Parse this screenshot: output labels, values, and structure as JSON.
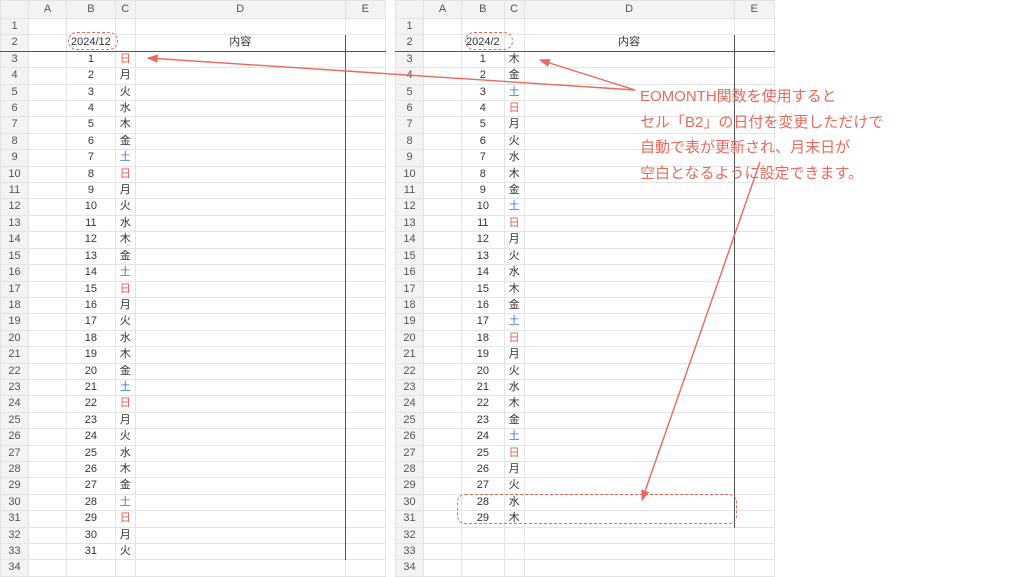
{
  "columns": [
    "",
    "A",
    "B",
    "C",
    "D",
    "E"
  ],
  "rowCount": 34,
  "left": {
    "date": "2024/12",
    "contentHeader": "内容",
    "days": [
      {
        "n": 1,
        "w": "日",
        "c": "sun"
      },
      {
        "n": 2,
        "w": "月"
      },
      {
        "n": 3,
        "w": "火"
      },
      {
        "n": 4,
        "w": "水"
      },
      {
        "n": 5,
        "w": "木"
      },
      {
        "n": 6,
        "w": "金"
      },
      {
        "n": 7,
        "w": "土",
        "c": "sat"
      },
      {
        "n": 8,
        "w": "日",
        "c": "sun"
      },
      {
        "n": 9,
        "w": "月"
      },
      {
        "n": 10,
        "w": "火"
      },
      {
        "n": 11,
        "w": "水"
      },
      {
        "n": 12,
        "w": "木"
      },
      {
        "n": 13,
        "w": "金"
      },
      {
        "n": 14,
        "w": "土",
        "c": "sat"
      },
      {
        "n": 15,
        "w": "日",
        "c": "sun"
      },
      {
        "n": 16,
        "w": "月"
      },
      {
        "n": 17,
        "w": "火"
      },
      {
        "n": 18,
        "w": "水"
      },
      {
        "n": 19,
        "w": "木"
      },
      {
        "n": 20,
        "w": "金"
      },
      {
        "n": 21,
        "w": "土",
        "c": "sat"
      },
      {
        "n": 22,
        "w": "日",
        "c": "sun"
      },
      {
        "n": 23,
        "w": "月"
      },
      {
        "n": 24,
        "w": "火"
      },
      {
        "n": 25,
        "w": "水"
      },
      {
        "n": 26,
        "w": "木"
      },
      {
        "n": 27,
        "w": "金"
      },
      {
        "n": 28,
        "w": "土",
        "c": "sat"
      },
      {
        "n": 29,
        "w": "日",
        "c": "sun"
      },
      {
        "n": 30,
        "w": "月"
      },
      {
        "n": 31,
        "w": "火"
      }
    ]
  },
  "right": {
    "date": "2024/2",
    "contentHeader": "内容",
    "days": [
      {
        "n": 1,
        "w": "木"
      },
      {
        "n": 2,
        "w": "金"
      },
      {
        "n": 3,
        "w": "土",
        "c": "sat"
      },
      {
        "n": 4,
        "w": "日",
        "c": "sun"
      },
      {
        "n": 5,
        "w": "月"
      },
      {
        "n": 6,
        "w": "火"
      },
      {
        "n": 7,
        "w": "水"
      },
      {
        "n": 8,
        "w": "木"
      },
      {
        "n": 9,
        "w": "金"
      },
      {
        "n": 10,
        "w": "土",
        "c": "sat"
      },
      {
        "n": 11,
        "w": "日",
        "c": "sun"
      },
      {
        "n": 12,
        "w": "月"
      },
      {
        "n": 13,
        "w": "火"
      },
      {
        "n": 14,
        "w": "水"
      },
      {
        "n": 15,
        "w": "木"
      },
      {
        "n": 16,
        "w": "金"
      },
      {
        "n": 17,
        "w": "土",
        "c": "sat"
      },
      {
        "n": 18,
        "w": "日",
        "c": "sun"
      },
      {
        "n": 19,
        "w": "月"
      },
      {
        "n": 20,
        "w": "火"
      },
      {
        "n": 21,
        "w": "水"
      },
      {
        "n": 22,
        "w": "木"
      },
      {
        "n": 23,
        "w": "金"
      },
      {
        "n": 24,
        "w": "土",
        "c": "sat"
      },
      {
        "n": 25,
        "w": "日",
        "c": "sun"
      },
      {
        "n": 26,
        "w": "月"
      },
      {
        "n": 27,
        "w": "火"
      },
      {
        "n": 28,
        "w": "水"
      },
      {
        "n": 29,
        "w": "木"
      }
    ]
  },
  "annotation": {
    "line1": "EOMONTH関数を使用すると",
    "line2": "セル「B2」の日付を変更しただけで",
    "line3": "自動で表が更新され、月末日が",
    "line4": "空白となるように設定できます。"
  }
}
